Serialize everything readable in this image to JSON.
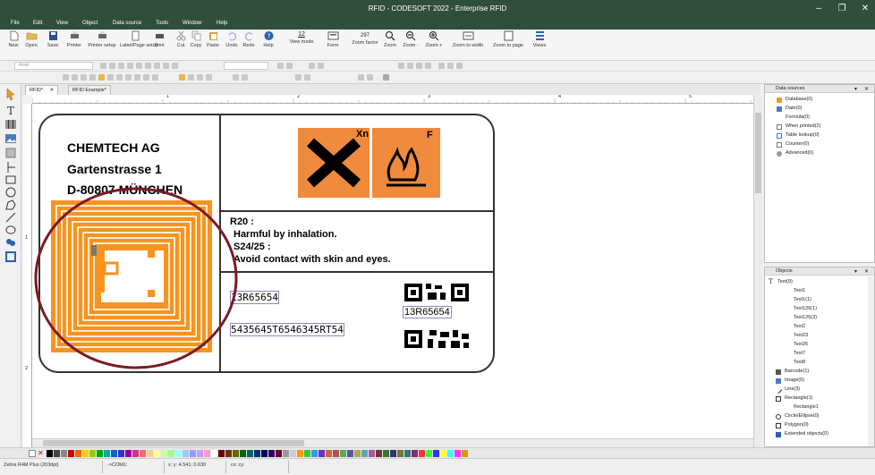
{
  "window": {
    "title": "RFID - CODESOFT 2022 - Enterprise RFID",
    "min": "–",
    "max": "❐",
    "close": "✕"
  },
  "menu": [
    "File",
    "Edit",
    "View",
    "Object",
    "Data source",
    "Tools",
    "Window",
    "Help"
  ],
  "ribbon": [
    {
      "label": "New"
    },
    {
      "label": "Open"
    },
    {
      "label": "Save"
    },
    {
      "label": "Printer"
    },
    {
      "label": "Printer setup"
    },
    {
      "label": "Label/Page setup"
    },
    {
      "label": "Print"
    },
    {
      "label": "Cut"
    },
    {
      "label": "Copy"
    },
    {
      "label": "Paste"
    },
    {
      "label": "Undo"
    },
    {
      "label": "Redo"
    },
    {
      "label": "Help"
    },
    {
      "label": "View mode"
    },
    {
      "label": "Form"
    },
    {
      "label": "Zoom factor"
    },
    {
      "label": "Zoom"
    },
    {
      "label": "Zoom -"
    },
    {
      "label": "Zoom +"
    },
    {
      "label": "Zoom to width"
    },
    {
      "label": "Zoom to page"
    },
    {
      "label": "Views"
    }
  ],
  "ribbon_values": {
    "view_mode_value": "12",
    "zoom_factor_value": "297"
  },
  "font_box": {
    "value": "Arial"
  },
  "tabs": [
    {
      "label": "RFID*"
    },
    {
      "label": "RFID Example*"
    }
  ],
  "tab_close": "✕",
  "ruler_marks": [
    "1",
    "2",
    "3",
    "4",
    "5"
  ],
  "vruler_marks": [
    "1",
    "2"
  ],
  "label": {
    "company": "CHEMTECH AG",
    "street": "Gartenstrasse 1",
    "city": "D-80807 MÜNCHEN",
    "hazard1_code": "Xn",
    "hazard2_code": "F",
    "r_code": "R20 :",
    "r_text": "Harmful by inhalation.",
    "s_code": "S24/25 :",
    "s_text": "Avoid contact with skin and eyes.",
    "code1": "13R65654",
    "code2": "5435645T6546345RT54",
    "qr_caption": "13R65654"
  },
  "colors": {
    "hazard_orange": "#f08a3c",
    "rfid_orange": "#f7941d",
    "circle": "#7a1a25",
    "titlebar": "#2f4f3c"
  },
  "datasources": {
    "title": "Data sources",
    "items": [
      "Database(0)",
      "Date(0)",
      "Formula(0)",
      "When printed(2)",
      "Table lookup(0)",
      "Counter(0)",
      "Advanced(0)"
    ]
  },
  "objects": {
    "title": "Objects",
    "text_group": "Text(9)",
    "text_items": [
      "Text1",
      "Text1(1)",
      "Text126(1)",
      "Text126(3)",
      "Text2",
      "Text23",
      "Text26",
      "Text7",
      "Text8"
    ],
    "other_groups": [
      "Barcode(1)",
      "Image(0)",
      "Line(3)",
      "Rectangle(1)"
    ],
    "rect_child": "Rectangle1",
    "more_groups": [
      "Circle/Ellipse(0)",
      "Polygon(0)",
      "Extended objects(0)"
    ]
  },
  "panel_pin": "▾",
  "panel_close": "✕",
  "status": {
    "printer": "Zebra R4M Plus (203dpi)",
    "port": "->COM1:",
    "coords": "x: y: 4.541; 0.630",
    "size": "cx: cy:"
  }
}
